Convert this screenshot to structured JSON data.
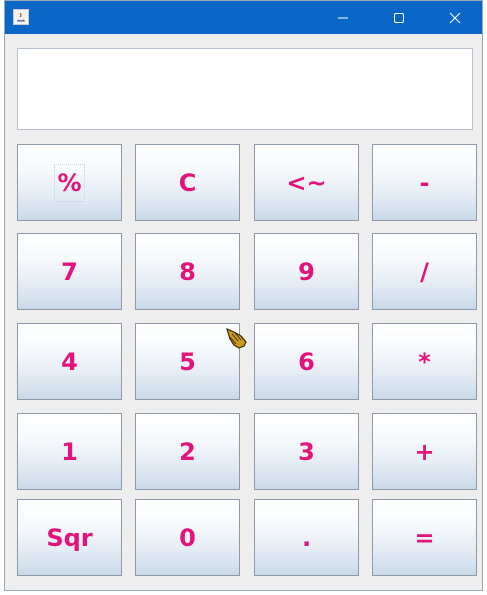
{
  "window": {
    "controls": {
      "minimize_icon": "minimize-icon",
      "maximize_icon": "maximize-icon",
      "close_icon": "close-icon"
    }
  },
  "display": {
    "value": ""
  },
  "keys": [
    {
      "label": "%"
    },
    {
      "label": "C"
    },
    {
      "label": "<~"
    },
    {
      "label": "-"
    },
    {
      "label": "7"
    },
    {
      "label": "8"
    },
    {
      "label": "9"
    },
    {
      "label": "/"
    },
    {
      "label": "4"
    },
    {
      "label": "5"
    },
    {
      "label": "6"
    },
    {
      "label": "*"
    },
    {
      "label": "1"
    },
    {
      "label": "2"
    },
    {
      "label": "3"
    },
    {
      "label": "+"
    },
    {
      "label": "Sqr"
    },
    {
      "label": "0"
    },
    {
      "label": "."
    },
    {
      "label": "="
    }
  ],
  "colors": {
    "titlebar": "#0a67c8",
    "key_text": "#e2137a",
    "background": "#eeeeee"
  }
}
